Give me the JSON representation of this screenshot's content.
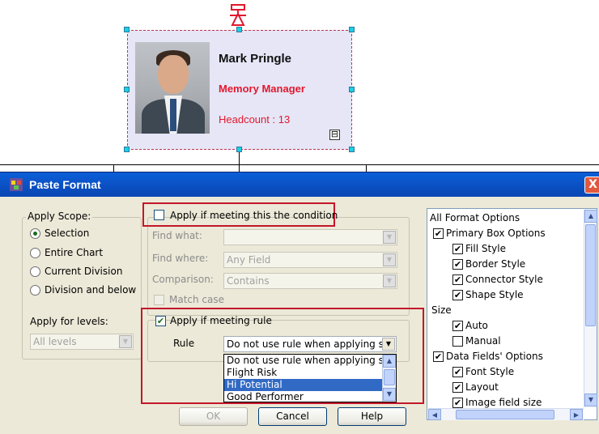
{
  "org_card": {
    "name": "Mark Pringle",
    "title": "Memory Manager",
    "headcount": "Headcount : 13",
    "collapse_symbol": "⊟"
  },
  "dialog": {
    "title": "Paste Format",
    "close_symbol": "X",
    "apply_scope": {
      "legend": "Apply Scope:",
      "options": [
        "Selection",
        "Entire Chart",
        "Current Division",
        "Division and below"
      ],
      "selected": "Selection",
      "levels_label": "Apply for levels:",
      "levels_value": "All levels"
    },
    "condition": {
      "checkbox_label": "Apply if meeting this the condition",
      "find_what_label": "Find what:",
      "find_what_value": "",
      "find_where_label": "Find where:",
      "find_where_value": "Any Field",
      "comparison_label": "Comparison:",
      "comparison_value": "Contains",
      "match_case_label": "Match case"
    },
    "rule": {
      "checkbox_label": "Apply if meeting rule",
      "checked": true,
      "rule_label": "Rule",
      "rule_value": "Do not use rule when applying sty",
      "dropdown_items": [
        "Do not use rule when applying sty",
        "Flight Risk",
        "Hi Potential",
        "Good Performer"
      ],
      "selected_item": "Hi Potential"
    },
    "buttons": {
      "ok": "OK",
      "cancel": "Cancel",
      "help": "Help"
    },
    "format_options": {
      "root": "All Format Options",
      "primary_box": "Primary Box Options",
      "fill_style": "Fill Style",
      "border_style": "Border Style",
      "connector_style": "Connector Style",
      "shape_style": "Shape Style",
      "size": "Size",
      "auto": "Auto",
      "manual": "Manual",
      "data_fields": "Data Fields' Options",
      "font_style": "Font Style",
      "layout": "Layout",
      "image_field_size": "Image field size"
    }
  },
  "colors": {
    "title_blue": "#0b54c8",
    "highlight_red": "#c3162a",
    "selection_blue": "#316ac5",
    "card_bg": "#e6e6f7"
  }
}
